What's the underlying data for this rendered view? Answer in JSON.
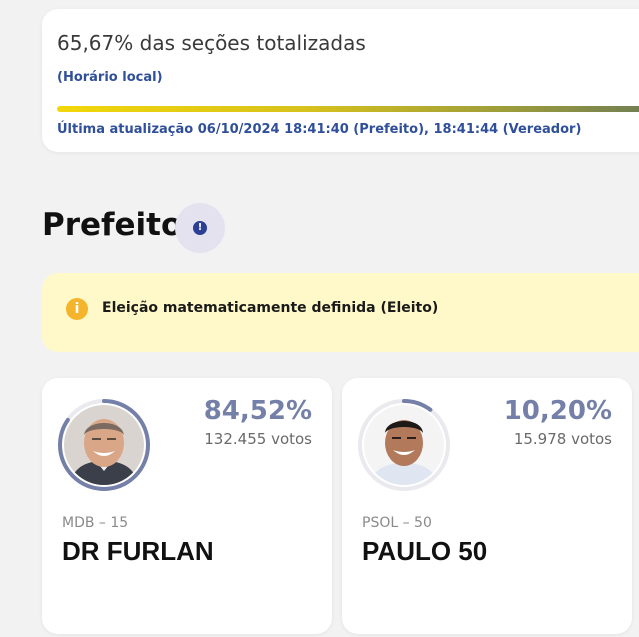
{
  "progress": {
    "title": "65,67% das seções totalizadas",
    "timezone_note": "(Horário local)",
    "percent": 65.67,
    "last_update": "Última atualização 06/10/2024 18:41:40 (Prefeito), 18:41:44 (Vereador)"
  },
  "section": {
    "title": "Prefeito",
    "info_icon": "info-icon"
  },
  "alert": {
    "icon": "info-circle-icon",
    "text": "Eleição matematicamente definida (Eleito)",
    "color": "#fff8c8"
  },
  "candidates": [
    {
      "percent": "84,52%",
      "percent_value": 84.52,
      "votes": "132.455 votos",
      "party": "MDB – 15",
      "name": "DR FURLAN"
    },
    {
      "percent": "10,20%",
      "percent_value": 10.2,
      "votes": "15.978 votos",
      "party": "PSOL – 50",
      "name": "PAULO 50"
    }
  ],
  "colors": {
    "accent": "#2f4f9a",
    "ring": "#7480a8",
    "progress_start": "#f2d70a",
    "progress_end": "#6b7a57"
  }
}
